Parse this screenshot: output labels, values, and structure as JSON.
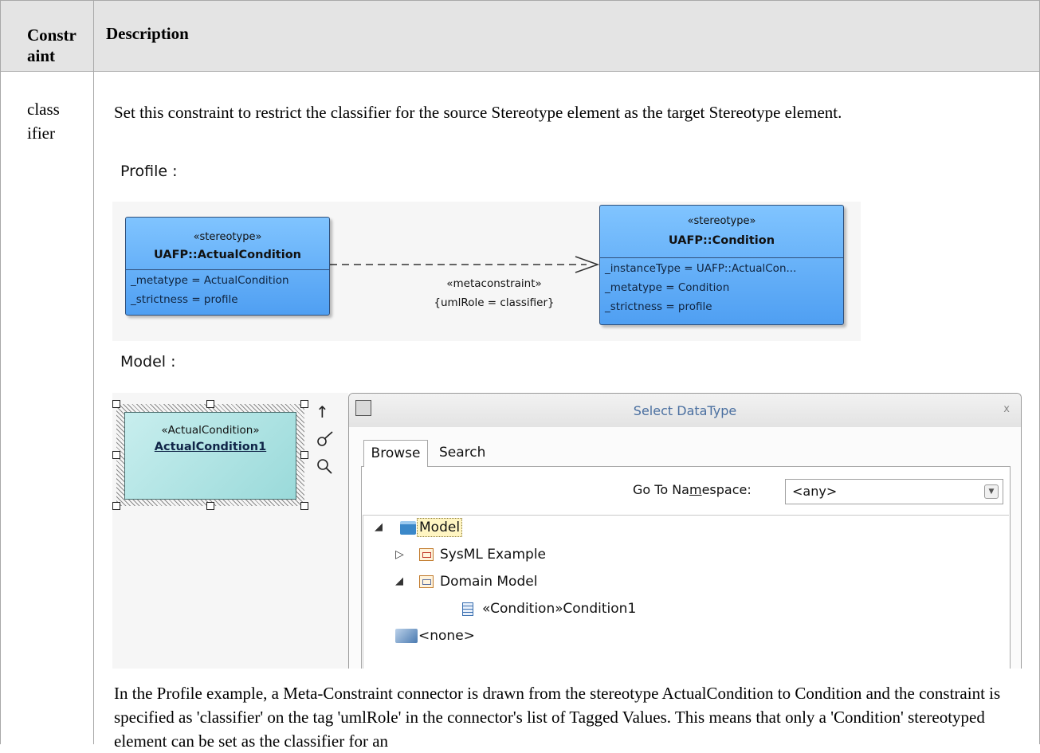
{
  "table": {
    "col1_header": "Constr aint",
    "col2_header": "Description",
    "row_constraint": "class ifier",
    "para1": "Set this constraint to restrict the classifier for the source Stereotype element as the target Stereotype element.",
    "para2": "In the Profile example, a Meta-Constraint connector is drawn from the stereotype ActualCondition to Condition and the constraint is specified as 'classifier' on the tag 'umlRole' in the connector's list of Tagged Values. This means that only a 'Condition' stereotyped element can be set as the classifier for an"
  },
  "profile": {
    "label": "Profile :",
    "source": {
      "stereotype": "«stereotype»",
      "name": "UAFP::ActualCondition",
      "attrs": [
        "_metatype = ActualCondition",
        "_strictness = profile"
      ]
    },
    "target": {
      "stereotype": "«stereotype»",
      "name": "UAFP::Condition",
      "attrs": [
        "_instanceType = UAFP::ActualCon...",
        "_metatype = Condition",
        "_strictness = profile"
      ]
    },
    "connector": {
      "stereotype": "«metaconstraint»",
      "tag": "{umlRole = classifier}"
    }
  },
  "model": {
    "label": "Model :",
    "element": {
      "stereotype": "«ActualCondition»",
      "name": "ActualCondition1"
    },
    "side_icons": [
      "up-arrow-icon",
      "brush-icon",
      "magnifier-icon"
    ]
  },
  "dialog": {
    "title": "Select DataType",
    "close": "x",
    "tabs": [
      "Browse",
      "Search"
    ],
    "namespace_label_pre": "Go To Na",
    "namespace_label_u": "m",
    "namespace_label_post": "espace:",
    "namespace_value": "<any>",
    "tree": {
      "root": "Model",
      "items": [
        "SysML Example",
        "Domain Model",
        "«Condition»Condition1"
      ],
      "none": "<none>"
    }
  }
}
